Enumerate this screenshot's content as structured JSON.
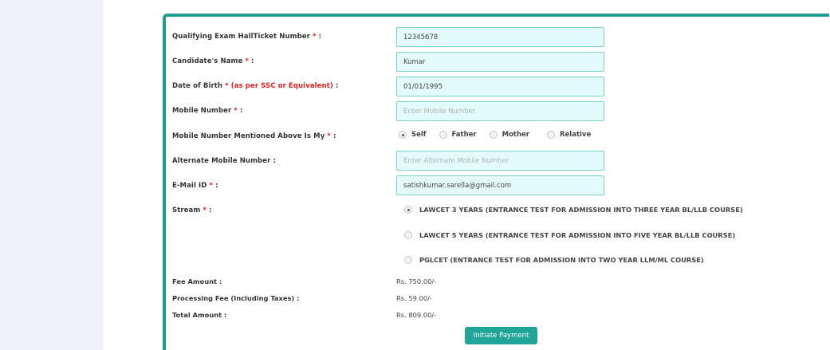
{
  "form": {
    "hallticket": {
      "label": "Qualifying Exam HallTicket Number",
      "req": "*",
      "colon": ":",
      "value": "12345678"
    },
    "name": {
      "label": "Candidate's Name",
      "req": "*",
      "colon": ":",
      "value": "Kumar"
    },
    "dob": {
      "label": "Date of Birth",
      "req": "* (as per SSC or Equivalent)",
      "colon": ":",
      "value": "01/01/1995"
    },
    "mobile": {
      "label": "Mobile Number",
      "req": "*",
      "colon": ":",
      "value": "",
      "placeholder": "Enter Mobile Number"
    },
    "mobile_owner": {
      "label": "Mobile Number Mentioned Above Is My",
      "req": "*",
      "colon": ":",
      "options": [
        "Self",
        "Father",
        "Mother",
        "Relative"
      ],
      "selected": "Self"
    },
    "alt_mobile": {
      "label": "Alternate Mobile Number",
      "colon": ":",
      "value": "",
      "placeholder": "Enter Alternate Mobile Number"
    },
    "email": {
      "label": "E-Mail ID",
      "req": "*",
      "colon": ":",
      "value": "satishkumar.sarella@gmail.com"
    },
    "stream": {
      "label": "Stream",
      "req": "*",
      "colon": ":",
      "options": [
        "LAWCET 3 YEARS (ENTRANCE TEST FOR ADMISSION INTO THREE YEAR BL/LLB COURSE)",
        "LAWCET 5 YEARS (ENTRANCE TEST FOR ADMISSION INTO FIVE YEAR BL/LLB COURSE)",
        "PGLCET (ENTRANCE TEST FOR ADMISSION INTO TWO YEAR LLM/ML COURSE)"
      ],
      "selected_index": 0
    },
    "fees": {
      "fee_label": "Fee Amount :",
      "fee_value": "Rs. 750.00/-",
      "processing_label": "Processing Fee (Including Taxes) :",
      "processing_value": "Rs. 59.00/-",
      "total_label": "Total Amount :",
      "total_value": "Rs. 809.00/-"
    },
    "submit_label": "Initiate Payment"
  },
  "colors": {
    "accent": "#1f9c8c",
    "field_bg": "#e4fbfb",
    "required": "#e02020",
    "button": "#1fa497"
  }
}
